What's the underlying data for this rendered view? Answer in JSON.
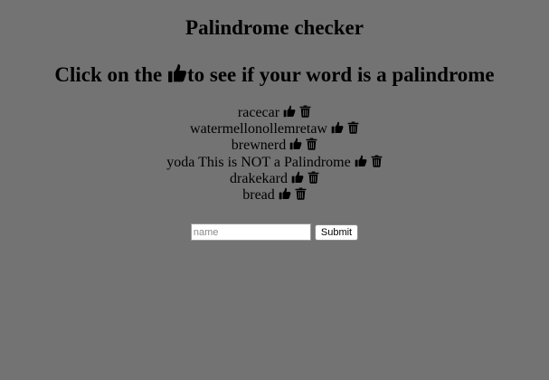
{
  "header": {
    "title": "Palindrome checker",
    "subtitle_before": "Click on the ",
    "subtitle_after": "to see if your word is a palindrome"
  },
  "words": [
    {
      "text": "racecar",
      "note": ""
    },
    {
      "text": "watermellonollemretaw",
      "note": ""
    },
    {
      "text": "brewnerd",
      "note": ""
    },
    {
      "text": "yoda",
      "note": "This is NOT a Palindrome"
    },
    {
      "text": "drakekard",
      "note": ""
    },
    {
      "text": "bread",
      "note": ""
    }
  ],
  "icons": {
    "check": "thumbs-up-icon",
    "delete": "trash-icon"
  },
  "form": {
    "placeholder": "name",
    "value": "",
    "submit_label": "Submit"
  },
  "colors": {
    "background": "#737373",
    "text": "#000000"
  }
}
